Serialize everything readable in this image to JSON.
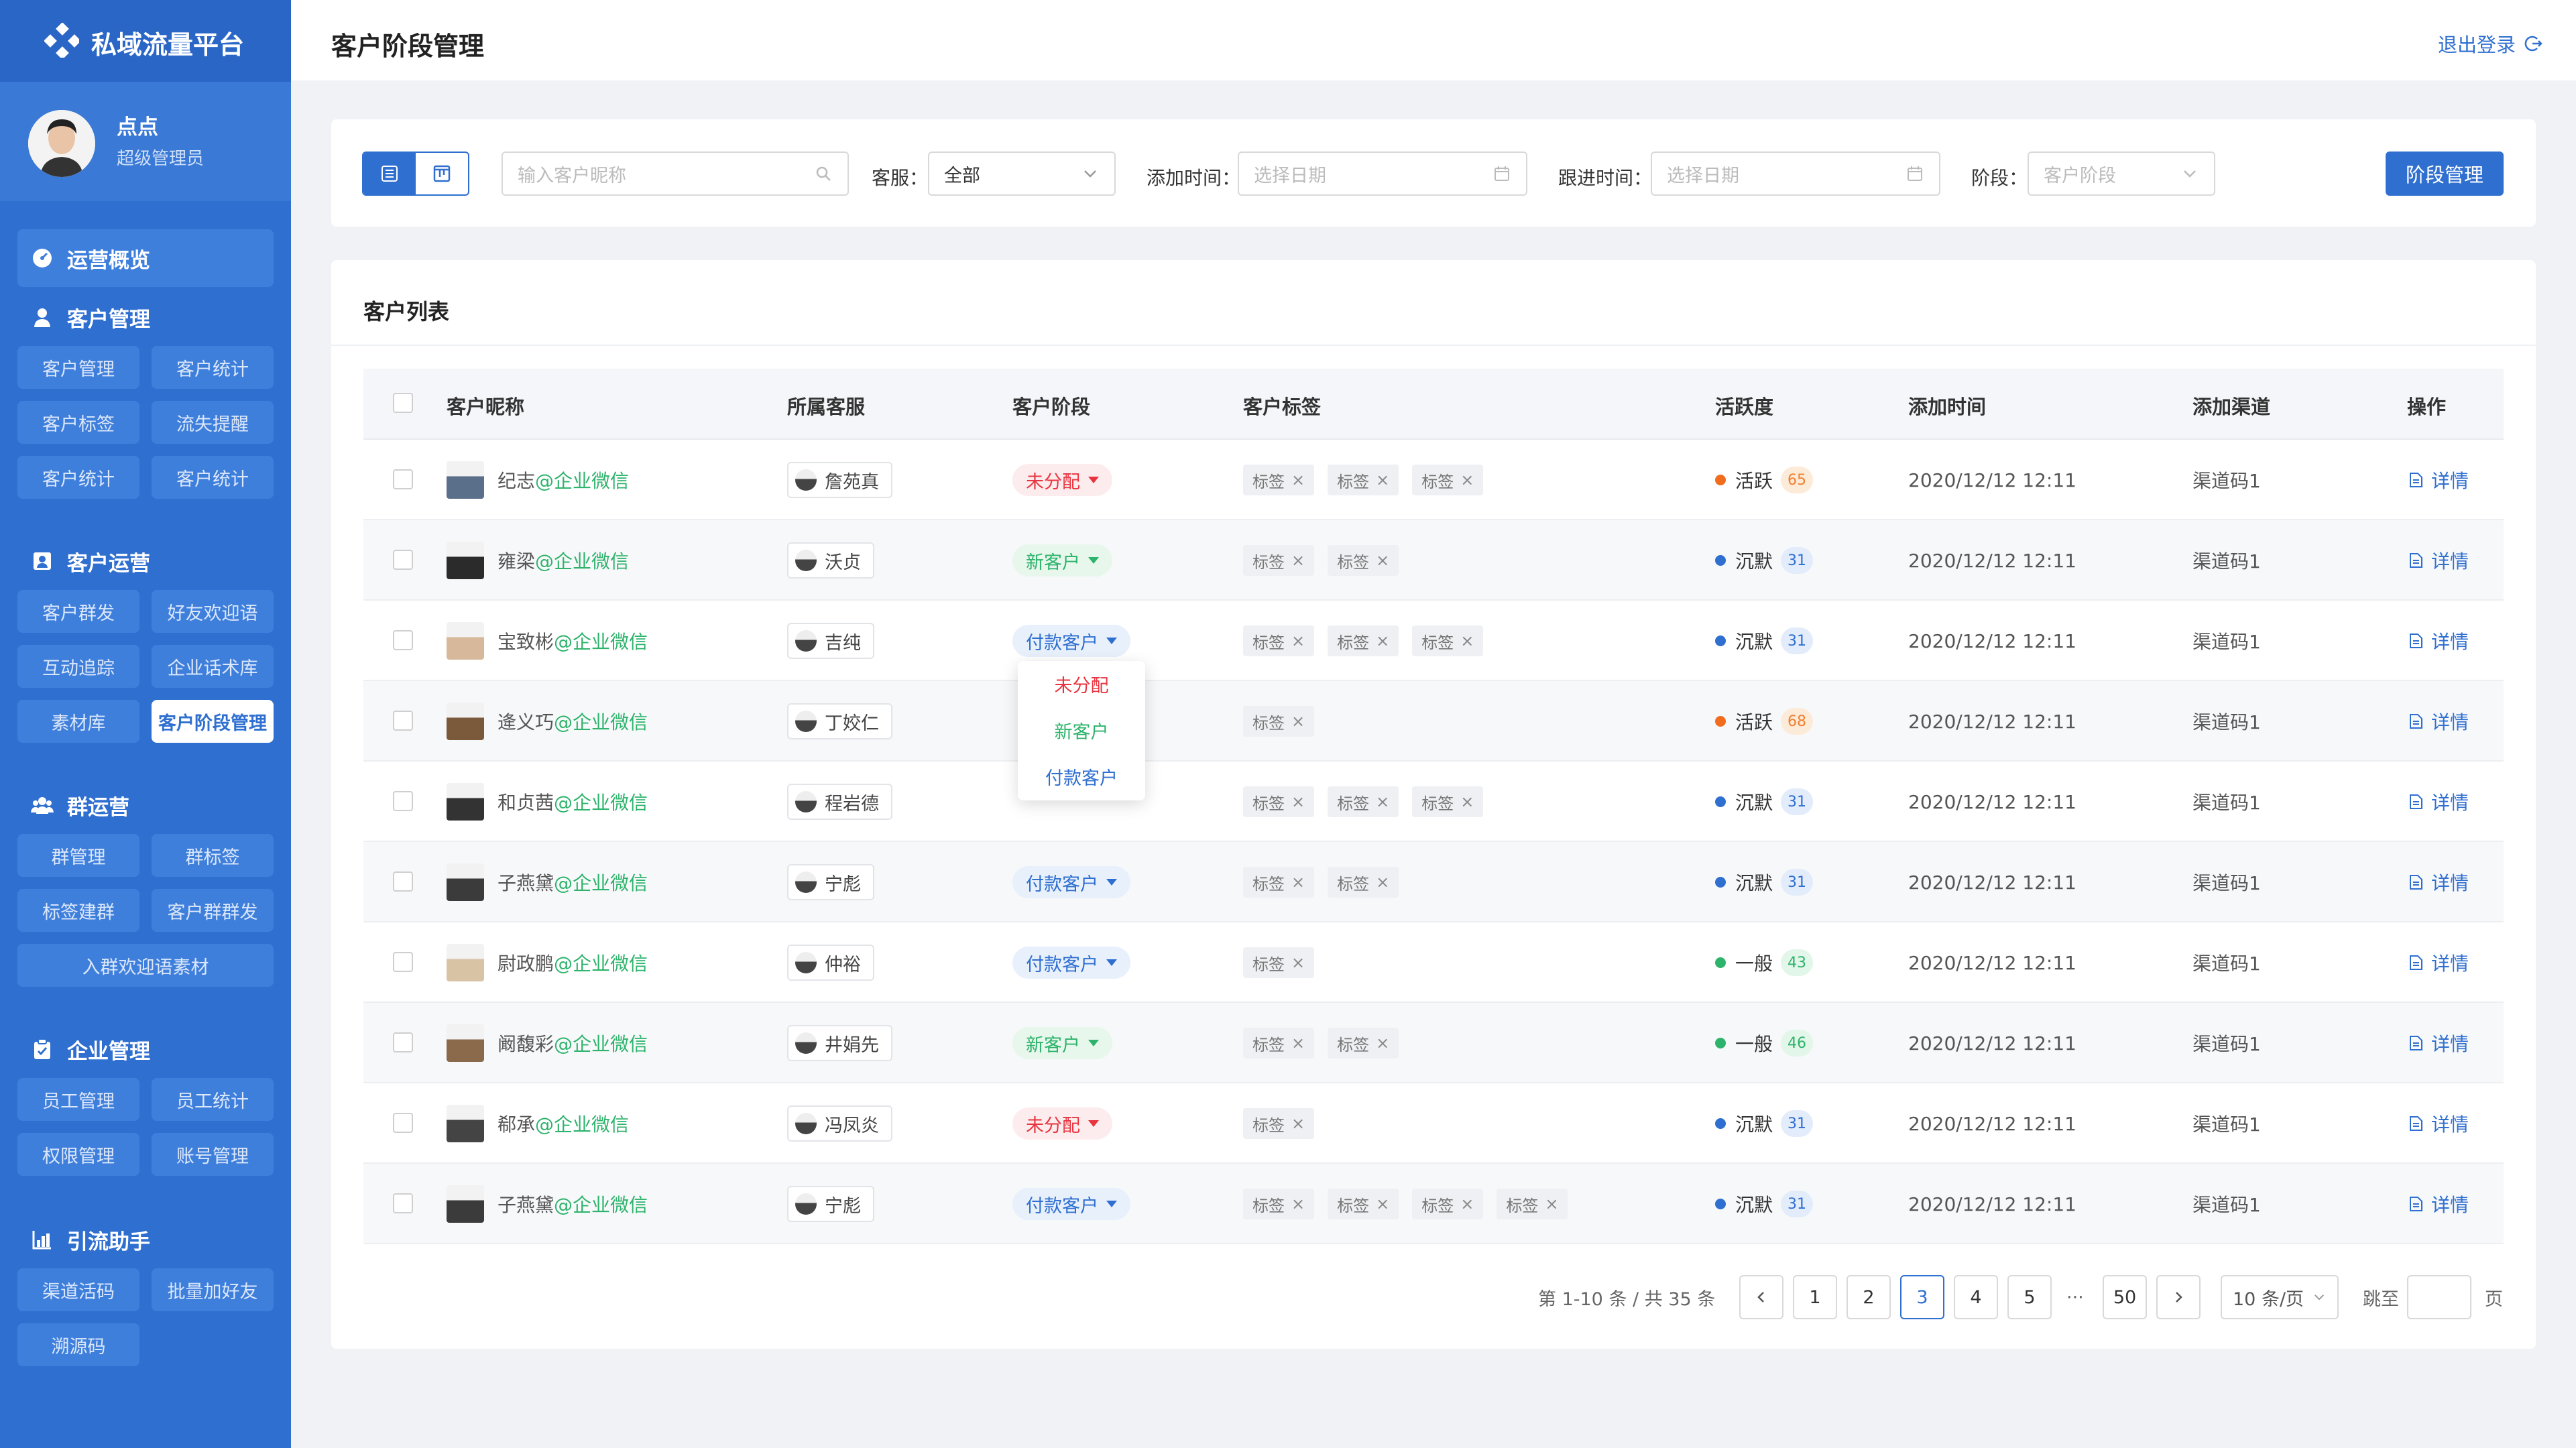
{
  "brand": {
    "title": "私域流量平台"
  },
  "user": {
    "name": "点点",
    "role": "超级管理员"
  },
  "sidebar": {
    "overview": "运营概览",
    "groups": [
      {
        "title": "客户管理",
        "items": [
          "客户管理",
          "客户统计",
          "客户标签",
          "流失提醒",
          "客户统计",
          "客户统计"
        ]
      },
      {
        "title": "客户运营",
        "items": [
          "客户群发",
          "好友欢迎语",
          "互动追踪",
          "企业话术库",
          "素材库",
          "客户阶段管理"
        ]
      },
      {
        "title": "群运营",
        "items": [
          "群管理",
          "群标签",
          "标签建群",
          "客户群群发",
          "入群欢迎语素材"
        ]
      },
      {
        "title": "企业管理",
        "items": [
          "员工管理",
          "员工统计",
          "权限管理",
          "账号管理"
        ]
      },
      {
        "title": "引流助手",
        "items": [
          "渠道活码",
          "批量加好友",
          "溯源码"
        ]
      }
    ]
  },
  "header": {
    "title": "客户阶段管理",
    "logout": "退出登录"
  },
  "filters": {
    "search_placeholder": "输入客户昵称",
    "agent_label": "客服：",
    "agent_value": "全部",
    "add_time_label": "添加时间：",
    "add_time_placeholder": "选择日期",
    "follow_time_label": "跟进时间：",
    "follow_time_placeholder": "选择日期",
    "stage_label": "阶段：",
    "stage_placeholder": "客户阶段",
    "stage_button": "阶段管理"
  },
  "table": {
    "title": "客户列表",
    "columns": [
      "客户昵称",
      "所属客服",
      "客户阶段",
      "客户标签",
      "活跃度",
      "添加时间",
      "添加渠道",
      "操作"
    ],
    "rows": [
      {
        "name": "纪志",
        "corp": "@企业微信",
        "agent": "詹苑真",
        "stage": "未分配",
        "stage_color": "red",
        "tags": [
          "标签",
          "标签",
          "标签"
        ],
        "activity": "活跃",
        "activity_color": "orange",
        "score": "65",
        "time": "2020/12/12 12:11",
        "channel": "渠道码1",
        "action": "详情"
      },
      {
        "name": "雍梁",
        "corp": "@企业微信",
        "agent": "沃贞",
        "stage": "新客户",
        "stage_color": "green",
        "tags": [
          "标签",
          "标签"
        ],
        "activity": "沉默",
        "activity_color": "blue",
        "score": "31",
        "time": "2020/12/12 12:11",
        "channel": "渠道码1",
        "action": "详情"
      },
      {
        "name": "宝致彬",
        "corp": "@企业微信",
        "agent": "吉纯",
        "stage": "付款客户",
        "stage_color": "blue",
        "tags": [
          "标签",
          "标签",
          "标签"
        ],
        "activity": "沉默",
        "activity_color": "blue",
        "score": "31",
        "time": "2020/12/12 12:11",
        "channel": "渠道码1",
        "action": "详情"
      },
      {
        "name": "逄义巧",
        "corp": "@企业微信",
        "agent": "丁姣仁",
        "stage": "",
        "stage_color": "",
        "tags": [
          "标签"
        ],
        "activity": "活跃",
        "activity_color": "orange",
        "score": "68",
        "time": "2020/12/12 12:11",
        "channel": "渠道码1",
        "action": "详情"
      },
      {
        "name": "和贞茜",
        "corp": "@企业微信",
        "agent": "程岩德",
        "stage": "",
        "stage_color": "",
        "tags": [
          "标签",
          "标签",
          "标签"
        ],
        "activity": "沉默",
        "activity_color": "blue",
        "score": "31",
        "time": "2020/12/12 12:11",
        "channel": "渠道码1",
        "action": "详情"
      },
      {
        "name": "子燕黛",
        "corp": "@企业微信",
        "agent": "宁彪",
        "stage": "付款客户",
        "stage_color": "blue",
        "tags": [
          "标签",
          "标签"
        ],
        "activity": "沉默",
        "activity_color": "blue",
        "score": "31",
        "time": "2020/12/12 12:11",
        "channel": "渠道码1",
        "action": "详情"
      },
      {
        "name": "尉政鹏",
        "corp": "@企业微信",
        "agent": "仲裕",
        "stage": "付款客户",
        "stage_color": "blue",
        "tags": [
          "标签"
        ],
        "activity": "一般",
        "activity_color": "green",
        "score": "43",
        "time": "2020/12/12 12:11",
        "channel": "渠道码1",
        "action": "详情"
      },
      {
        "name": "阚馥彩",
        "corp": "@企业微信",
        "agent": "井娟先",
        "stage": "新客户",
        "stage_color": "green",
        "tags": [
          "标签",
          "标签"
        ],
        "activity": "一般",
        "activity_color": "green",
        "score": "46",
        "time": "2020/12/12 12:11",
        "channel": "渠道码1",
        "action": "详情"
      },
      {
        "name": "郗承",
        "corp": "@企业微信",
        "agent": "冯凤炎",
        "stage": "未分配",
        "stage_color": "red",
        "tags": [
          "标签"
        ],
        "activity": "沉默",
        "activity_color": "blue",
        "score": "31",
        "time": "2020/12/12 12:11",
        "channel": "渠道码1",
        "action": "详情"
      },
      {
        "name": "子燕黛",
        "corp": "@企业微信",
        "agent": "宁彪",
        "stage": "付款客户",
        "stage_color": "blue",
        "tags": [
          "标签",
          "标签",
          "标签",
          "标签"
        ],
        "activity": "沉默",
        "activity_color": "blue",
        "score": "31",
        "time": "2020/12/12 12:11",
        "channel": "渠道码1",
        "action": "详情"
      }
    ]
  },
  "stage_dropdown": {
    "options": [
      {
        "label": "未分配",
        "color": "#e8343f"
      },
      {
        "label": "新客户",
        "color": "#2db36b"
      },
      {
        "label": "付款客户",
        "color": "#2f6fd0"
      }
    ]
  },
  "pagination": {
    "summary": "第 1-10 条 / 共 35 条",
    "pages": [
      "1",
      "2",
      "3",
      "4",
      "5",
      "···",
      "50"
    ],
    "current": "3",
    "page_size": "10 条/页",
    "jump_label": "跳至",
    "page_suffix": "页"
  },
  "colors": {
    "primary": "#2f6fd0",
    "sidebar": "#2f6fd0",
    "danger": "#e8343f",
    "success": "#2db36b",
    "warning": "#f26c1d"
  }
}
